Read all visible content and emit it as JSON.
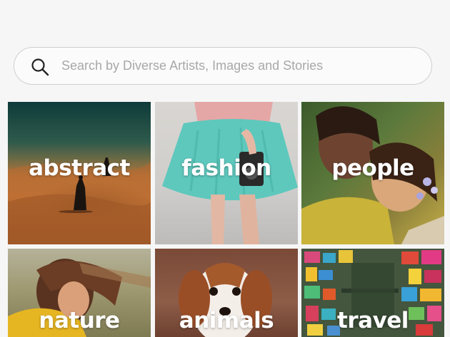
{
  "search": {
    "placeholder": "Search by Diverse Artists, Images and Stories",
    "value": ""
  },
  "categories": [
    {
      "label": "abstract"
    },
    {
      "label": "fashion"
    },
    {
      "label": "people"
    },
    {
      "label": "nature"
    },
    {
      "label": "animals"
    },
    {
      "label": "travel"
    }
  ],
  "icons": {
    "search": "search-icon"
  },
  "colors": {
    "page_background": "#f6f6f6",
    "search_border": "#cfcfcf",
    "label_text": "#ffffff"
  }
}
